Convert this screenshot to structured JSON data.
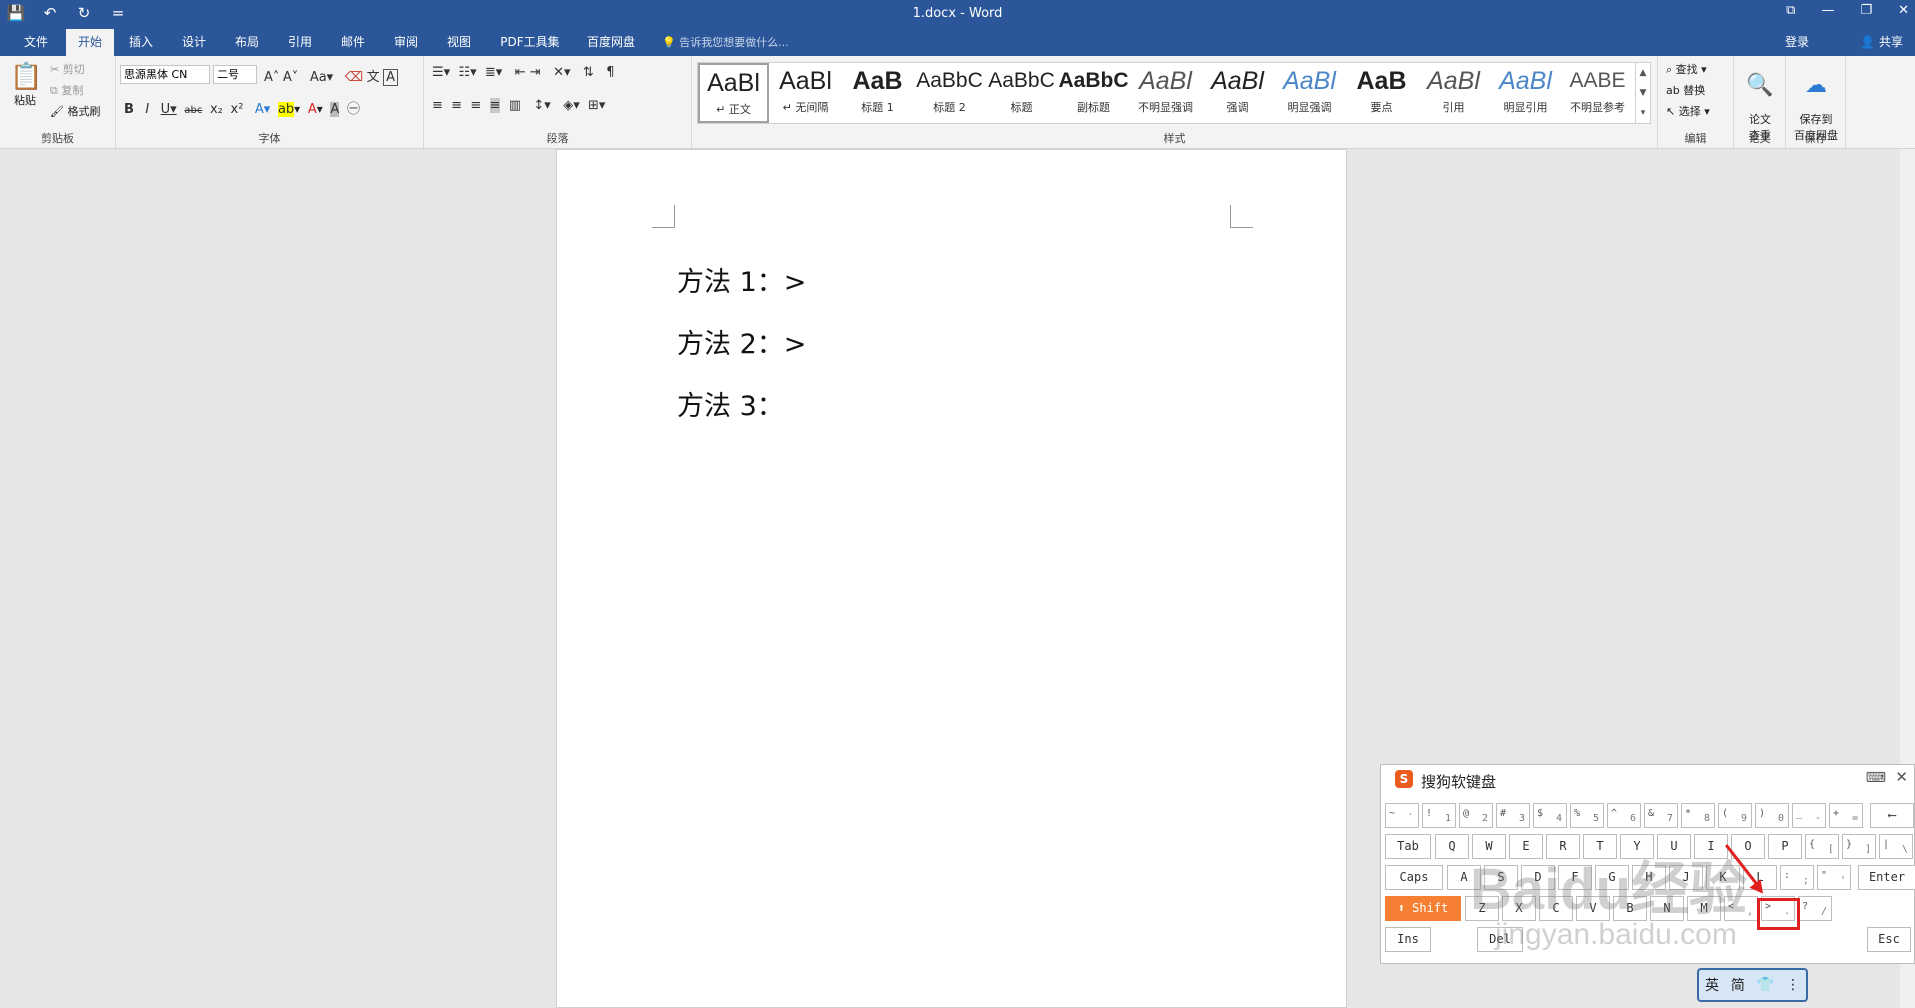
{
  "window": {
    "title": "1.docx - Word",
    "controls": [
      "⧉",
      "—",
      "❐",
      "✕"
    ]
  },
  "qat": [
    "💾",
    "↶",
    "↻",
    "="
  ],
  "tabs": [
    {
      "label": "文件"
    },
    {
      "label": "开始"
    },
    {
      "label": "插入"
    },
    {
      "label": "设计"
    },
    {
      "label": "布局"
    },
    {
      "label": "引用"
    },
    {
      "label": "邮件"
    },
    {
      "label": "审阅"
    },
    {
      "label": "视图"
    },
    {
      "label": "PDF工具集"
    },
    {
      "label": "百度网盘"
    }
  ],
  "tellme": "告诉我您想要做什么...",
  "signin": "登录",
  "share": "共享",
  "clipboard": {
    "paste": "粘贴",
    "cut": "剪切",
    "copy": "复制",
    "format_painter": "格式刷",
    "label": "剪贴板"
  },
  "font": {
    "name": "思源黑体 CN",
    "size": "二号",
    "label": "字体"
  },
  "paragraph": {
    "label": "段落"
  },
  "styles": {
    "label": "样式",
    "items": [
      {
        "preview": "AaBl",
        "name": "↵ 正文"
      },
      {
        "preview": "AaBl",
        "name": "↵ 无间隔"
      },
      {
        "preview": "AaB",
        "name": "标题 1"
      },
      {
        "preview": "AaBbC",
        "name": "标题 2"
      },
      {
        "preview": "AaBbC",
        "name": "标题"
      },
      {
        "preview": "AaBbC",
        "name": "副标题"
      },
      {
        "preview": "AaBl",
        "name": "不明显强调"
      },
      {
        "preview": "AaBl",
        "name": "强调"
      },
      {
        "preview": "AaBl",
        "name": "明显强调"
      },
      {
        "preview": "AaB",
        "name": "要点"
      },
      {
        "preview": "AaBl",
        "name": "引用"
      },
      {
        "preview": "AaBl",
        "name": "明显引用"
      },
      {
        "preview": "AABE",
        "name": "不明显参考"
      }
    ]
  },
  "editing": {
    "find": "查找",
    "replace": "替换",
    "select": "选择",
    "label": "编辑"
  },
  "paper": {
    "check": "论文\n查重",
    "label": "论文"
  },
  "save": {
    "baidu": "保存到\n百度网盘",
    "label": "保存"
  },
  "document": {
    "lines": [
      "方法 1：>",
      "方法 2：>",
      "方法 3："
    ]
  },
  "keyboard": {
    "title": "搜狗软键盘",
    "row1": [
      [
        "~",
        "`"
      ],
      [
        "!",
        "1"
      ],
      [
        "@",
        "2"
      ],
      [
        "#",
        "3"
      ],
      [
        "$",
        "4"
      ],
      [
        "%",
        "5"
      ],
      [
        "^",
        "6"
      ],
      [
        "&",
        "7"
      ],
      [
        "*",
        "8"
      ],
      [
        "(",
        "9"
      ],
      [
        ")",
        "0"
      ],
      [
        "_",
        "-"
      ],
      [
        "+",
        "="
      ]
    ],
    "backspace": "⟵",
    "tab": "Tab",
    "row2": [
      "Q",
      "W",
      "E",
      "R",
      "T",
      "Y",
      "U",
      "I",
      "O",
      "P"
    ],
    "row2_tail": [
      [
        "{",
        "["
      ],
      [
        "}",
        "]"
      ],
      [
        "|",
        "\\"
      ]
    ],
    "caps": "Caps",
    "row3": [
      "A",
      "S",
      "D",
      "F",
      "G",
      "H",
      "J",
      "K",
      "L"
    ],
    "row3_tail": [
      [
        ":",
        ";"
      ],
      [
        "\"",
        "'"
      ]
    ],
    "enter": "Enter",
    "shift": "⬆ Shift",
    "row4": [
      "Z",
      "X",
      "C",
      "V",
      "B",
      "N",
      "M"
    ],
    "row4_tail": [
      [
        "<",
        ","
      ],
      [
        ">",
        "."
      ],
      [
        "?",
        "/"
      ]
    ],
    "ins": "Ins",
    "del": "Del",
    "esc": "Esc"
  },
  "imebar": [
    "英",
    "简",
    "👕",
    "⋮"
  ],
  "watermark": "Baidu经验",
  "watermark_url": "jingyan.baidu.com",
  "colors": {
    "accent": "#2b579a",
    "shift": "#f57f32",
    "highlight": "#e02020"
  }
}
